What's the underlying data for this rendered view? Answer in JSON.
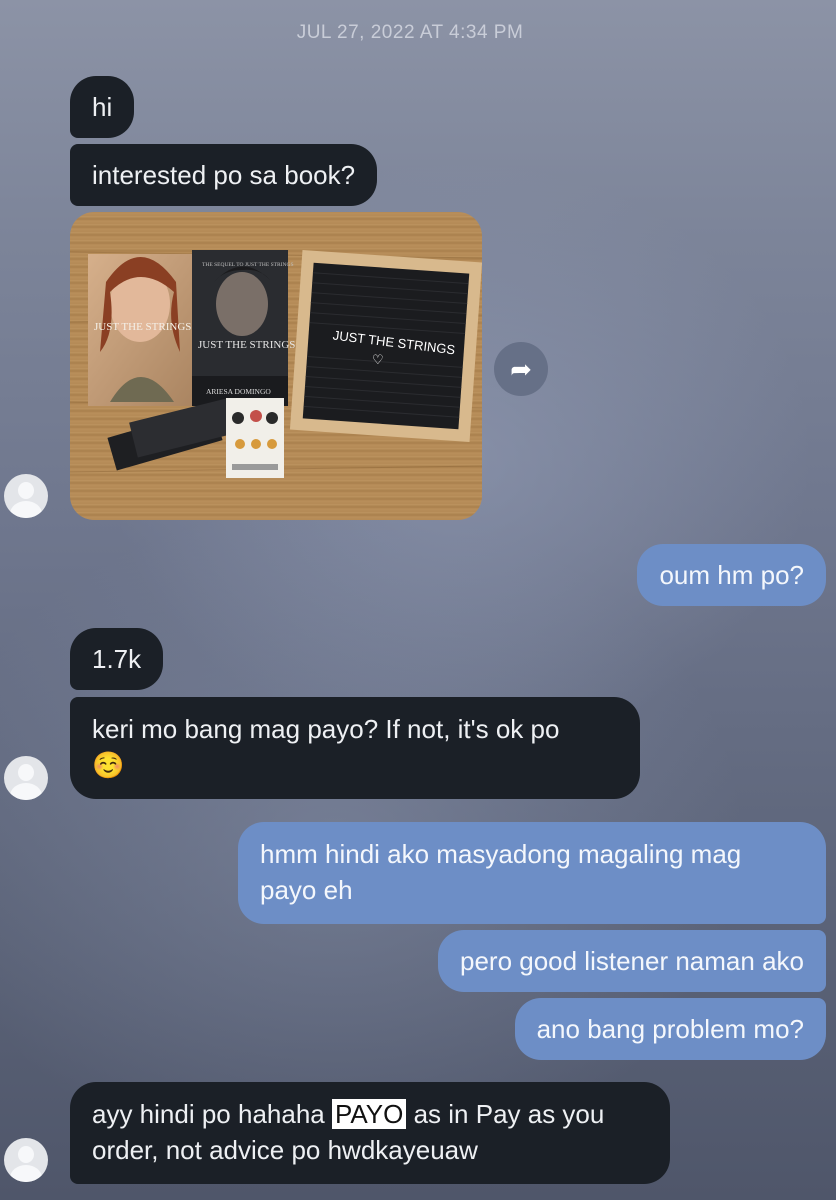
{
  "conversation": {
    "timestamp": "JUL 27, 2022 AT 4:34 PM",
    "messages": [
      {
        "text": "hi"
      },
      {
        "text": "interested po sa book?"
      },
      {
        "text": "oum hm po?"
      },
      {
        "text": "1.7k"
      },
      {
        "line1": "keri mo bang mag payo? If not, it's ok po",
        "emoji": "☺️"
      },
      {
        "line1": "hmm hindi ako masyadong magaling mag",
        "line2": "payo eh"
      },
      {
        "text": "pero good listener naman ako"
      },
      {
        "text": "ano bang problem mo?"
      },
      {
        "pre": "ayy hindi po hahaha ",
        "highlight": "PAYO",
        "post": " as in Pay as you",
        "line2": "order, not advice po hwdkayeuaw"
      }
    ],
    "photo": {
      "book1_title": "JUST THE STRINGS",
      "book2_title": "JUST THE STRINGS",
      "book2_header": "THE SEQUEL TO JUST THE STRINGS",
      "book2_author": "ARIESA DOMINGO",
      "board_text": "JUST THE STRINGS",
      "board_heart": "♡"
    },
    "share_icon": "share-arrow-icon",
    "colors": {
      "incoming_bubble": "#1b2027",
      "outgoing_bubble": "#6d8ec6"
    }
  }
}
